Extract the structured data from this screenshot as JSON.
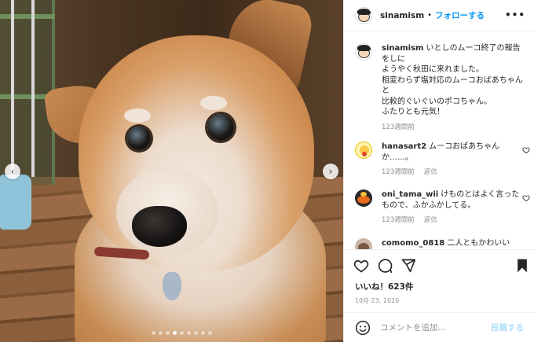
{
  "post": {
    "image_alt": "",
    "carousel": {
      "dot_count": 9,
      "active_index": 3
    },
    "nav": {
      "prev": "‹",
      "next": "›"
    }
  },
  "header": {
    "username": "sinamism",
    "separator": "•",
    "follow_label": "フォローする",
    "more_label": "•••"
  },
  "caption": {
    "username": "sinamism",
    "lines": [
      "いとしのムーコ終了の報告をしに",
      "ようやく秋田に来れました。",
      "相変わらず塩対応のムーコおばあちゃんと",
      "比較的ぐいぐいのポコちゃん。",
      "ふたりとも元気！"
    ],
    "time": "123週間前"
  },
  "comments": [
    {
      "username": "hanasart2",
      "text": "ムーコおばあちゃんか……。",
      "time": "123週間前",
      "reply": "返信"
    },
    {
      "username": "oni_tama_wii",
      "text": "けものとはよく言ったもので、ふかふかしてる。",
      "time": "123週間前",
      "reply": "返信"
    },
    {
      "username": "comomo_0818",
      "text": "二人ともかわいい",
      "time": "",
      "reply": ""
    }
  ],
  "likes": "いいね！623件",
  "date": "10月 23, 2020",
  "add_comment": {
    "placeholder": "コメントを追加...",
    "post_label": "投稿する"
  },
  "colors": {
    "accent": "#0095f6",
    "post_disabled": "#b2dffc",
    "muted": "#8e8e8e"
  }
}
